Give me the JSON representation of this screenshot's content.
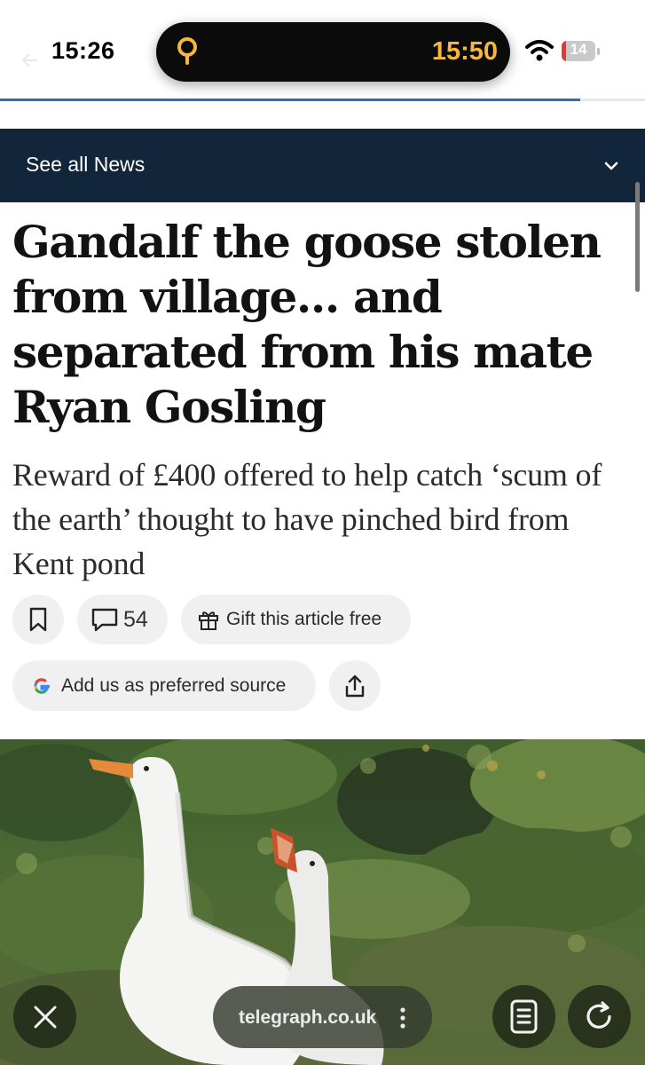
{
  "status_bar": {
    "time": "15:26",
    "island_time": "15:50",
    "battery_level": "14",
    "battery_fill_fraction": 0.14,
    "accent_color": "#f6b73c"
  },
  "reading_progress": 0.9,
  "nav": {
    "label": "See all News",
    "background_color": "#11263b"
  },
  "article": {
    "headline": "Gandalf the goose stolen from village... and separated from his mate Ryan Gosling",
    "standfirst": "Reward of £400 offered to help catch ‘scum of the earth’ thought to have pinched bird from Kent pond"
  },
  "actions": {
    "save_icon": "bookmark-icon",
    "comments_count": "54",
    "comments_icon": "comment-bubble-icon",
    "gift_label": "Gift this article free",
    "gift_icon": "gift-icon",
    "source_label": "Add us as preferred source",
    "source_icon": "google-g-icon",
    "share_icon": "share-icon"
  },
  "photo": {
    "subject": "two white geese"
  },
  "browser": {
    "url": "telegraph.co.uk",
    "close_icon": "close-icon",
    "more_icon": "vertical-ellipsis-icon",
    "reader_icon": "reader-mode-icon",
    "reload_icon": "reload-icon"
  }
}
